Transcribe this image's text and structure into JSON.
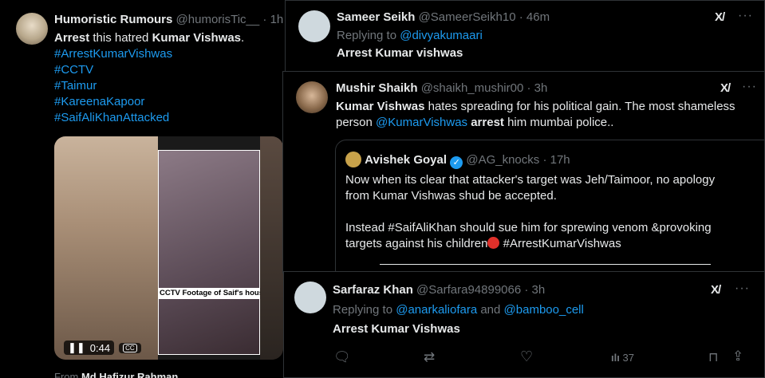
{
  "tweet1": {
    "display_name": "Humoristic Rumours",
    "handle": "@humorisTic__",
    "separator": "·",
    "time": "1h",
    "text_bold1": "Arrest",
    "text_mid": " this hatred ",
    "text_bold2": "Kumar Vishwas",
    "text_end": ".",
    "hashtags": [
      "#ArrestKumarVishwas",
      "#CCTV",
      "#Taimur",
      "#KareenaKapoor",
      "#SaifAliKhanAttacked"
    ],
    "media": {
      "caption": "CCTV Footage of Saif's house",
      "time": "0:44",
      "cc": "CC"
    },
    "from_label": "From",
    "from_name": "Md Hafizur Rahman"
  },
  "tweet2": {
    "display_name": "Sameer Seikh",
    "handle": "@SameerSeikh10",
    "time": "46m",
    "replying_to": "Replying to",
    "reply_handle": "@divyakumaari",
    "text": "Arrest Kumar vishwas",
    "grok": "X/",
    "more": "···"
  },
  "tweet3": {
    "display_name": "Mushir Shaikh",
    "handle": "@shaikh_mushir00",
    "time": "3h",
    "text_bold1": "Kumar Vishwas",
    "text_mid": " hates spreading for his political gain. The most shameless",
    "text_line2_start": "person ",
    "mention": "@KumarVishwas",
    "text_bold2": " arrest",
    "text_end": " him mumbai police..",
    "grok": "X/",
    "more": "···",
    "quote": {
      "display_name": "Avishek Goyal",
      "handle": "@AG_knocks",
      "time": "17h",
      "para1_line1": "Now when its clear that attacker's target was Jeh/Taimoor, no apology",
      "para1_line2": "from Kumar Vishwas shud be accepted.",
      "para2_line1": "Instead #SaifAliKhan should sue him for sprewing venom &provoking",
      "para2_line2": "targets against his children",
      "para2_tag": "#ArrestKumarVishwas"
    }
  },
  "tweet4": {
    "display_name": "Sarfaraz Khan",
    "handle": "@Sarfara94899066",
    "time": "3h",
    "replying_to": "Replying to",
    "reply_handle1": "@anarkaliofara",
    "reply_and": " and ",
    "reply_handle2": "@bamboo_cell",
    "text": "Arrest Kumar Vishwas",
    "grok": "X/",
    "more": "···",
    "actions": {
      "views": "37"
    }
  }
}
